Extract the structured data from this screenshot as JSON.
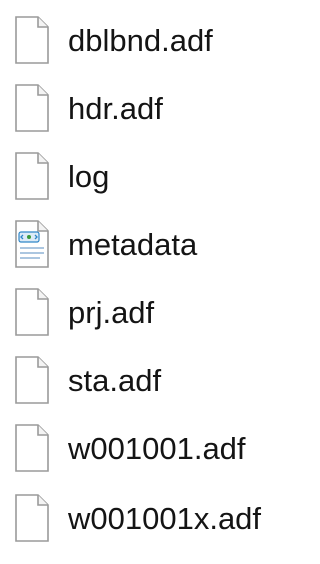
{
  "files": [
    {
      "name": "dblbnd.adf",
      "icon": "blank-file-icon"
    },
    {
      "name": "hdr.adf",
      "icon": "blank-file-icon"
    },
    {
      "name": "log",
      "icon": "blank-file-icon"
    },
    {
      "name": "metadata",
      "icon": "xml-document-icon"
    },
    {
      "name": "prj.adf",
      "icon": "blank-file-icon"
    },
    {
      "name": "sta.adf",
      "icon": "blank-file-icon"
    },
    {
      "name": "w001001.adf",
      "icon": "blank-file-icon"
    },
    {
      "name": "w001001x.adf",
      "icon": "blank-file-icon"
    }
  ],
  "colors": {
    "text": "#141414",
    "icon_outline": "#9a9a9a",
    "icon_fill": "#ffffff",
    "xml_accent": "#2f86c8"
  }
}
